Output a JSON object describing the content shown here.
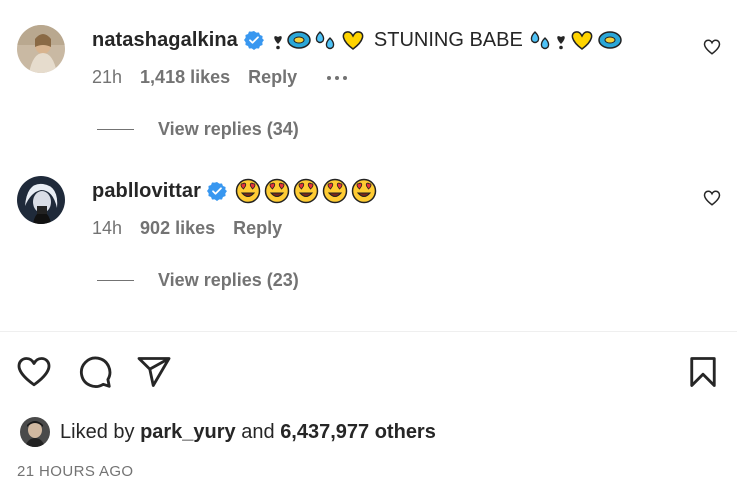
{
  "comments": [
    {
      "username": "natashagalkina",
      "text": "STUNING BABE",
      "time": "21h",
      "likes": "1,418 likes",
      "reply_label": "Reply",
      "view_replies": "View replies (34)"
    },
    {
      "username": "pabllovittar",
      "time": "14h",
      "likes": "902 likes",
      "reply_label": "Reply",
      "view_replies": "View replies (23)"
    }
  ],
  "liked_by": {
    "prefix": "Liked by",
    "user": "park_yury",
    "connector": "and",
    "others": "6,437,977 others"
  },
  "timestamp": "21 HOURS AGO",
  "colors": {
    "verified": "#3897f0",
    "text": "#262626",
    "secondary": "#737373",
    "divider": "#efefef"
  },
  "icons": [
    "verified-icon",
    "heart-icon",
    "comment-icon",
    "share-icon",
    "bookmark-icon",
    "more-icon"
  ]
}
